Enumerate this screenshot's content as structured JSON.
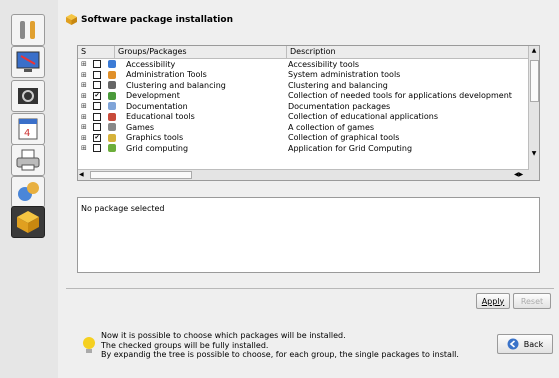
{
  "header": {
    "title": "Software package installation"
  },
  "sidebar": {
    "items": [
      {
        "name": "tools"
      },
      {
        "name": "display"
      },
      {
        "name": "hardware"
      },
      {
        "name": "calendar"
      },
      {
        "name": "printer"
      },
      {
        "name": "network"
      },
      {
        "name": "packages"
      }
    ]
  },
  "grid": {
    "columns": [
      "S",
      "Groups/Packages",
      "Description"
    ],
    "rows": [
      {
        "expand": "⊞",
        "checked": false,
        "icon": "accessibility-icon",
        "color": "#3b7bd6",
        "label": "Accessibility",
        "description": "Accessibility tools"
      },
      {
        "expand": "⊞",
        "checked": false,
        "icon": "admin-tools-icon",
        "color": "#e0902a",
        "label": "Administration Tools",
        "description": "System administration tools"
      },
      {
        "expand": "⊞",
        "checked": false,
        "icon": "cluster-icon",
        "color": "#666666",
        "label": "Clustering and balancing",
        "description": "Clustering and balancing"
      },
      {
        "expand": "⊞",
        "checked": true,
        "icon": "development-icon",
        "color": "#4a9a3a",
        "label": "Development",
        "description": "Collection of needed tools for applications development"
      },
      {
        "expand": "⊞",
        "checked": false,
        "icon": "documentation-icon",
        "color": "#7fa4d8",
        "label": "Documentation",
        "description": "Documentation packages"
      },
      {
        "expand": "⊞",
        "checked": false,
        "icon": "educational-icon",
        "color": "#c84a3a",
        "label": "Educational tools",
        "description": "Collection of educational applications"
      },
      {
        "expand": "⊞",
        "checked": false,
        "icon": "games-icon",
        "color": "#888888",
        "label": "Games",
        "description": "A collection of games"
      },
      {
        "expand": "⊞",
        "checked": true,
        "icon": "graphics-icon",
        "color": "#d6b23a",
        "label": "Graphics tools",
        "description": "Collection of graphical tools"
      },
      {
        "expand": "⊞",
        "checked": false,
        "icon": "grid-computing-icon",
        "color": "#6cae3a",
        "label": "Grid computing",
        "description": "Application for Grid Computing"
      }
    ]
  },
  "detail": {
    "text": "No package selected"
  },
  "buttons": {
    "apply": "Apply",
    "reset": "Reset",
    "back": "Back"
  },
  "info": {
    "line1": "Now it is possible to choose which packages will be installed.",
    "line2": "The checked groups will be fully installed.",
    "line3": "By expandig the tree is possible to choose, for each group, the single packages to install."
  }
}
